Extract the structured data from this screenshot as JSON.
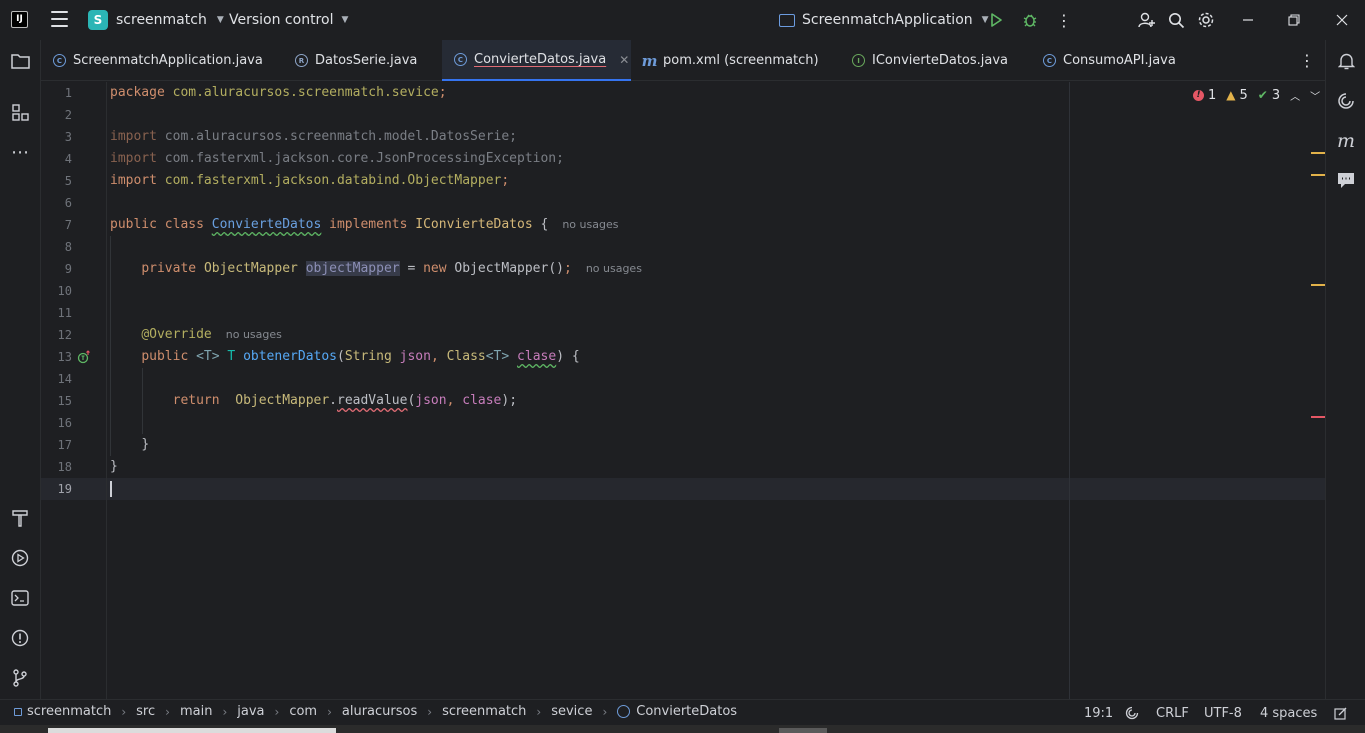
{
  "titlebar": {
    "project_letter": "S",
    "project_name": "screenmatch",
    "vcs_label": "Version control",
    "run_config": "ScreenmatchApplication",
    "icons": [
      "app-logo-icon",
      "main-menu-icon",
      "run-icon",
      "debug-icon",
      "more-vertical-icon",
      "add-user-icon",
      "search-icon",
      "settings-icon",
      "minimize-icon",
      "maximize-icon",
      "close-icon"
    ]
  },
  "tabs": [
    {
      "label": "ScreenmatchApplication.java",
      "icon": "class-icon",
      "active": false
    },
    {
      "label": "DatosSerie.java",
      "icon": "record-icon",
      "active": false
    },
    {
      "label": "ConvierteDatos.java",
      "icon": "class-icon",
      "active": true
    },
    {
      "label": "pom.xml (screenmatch)",
      "icon": "maven-icon",
      "active": false
    },
    {
      "label": "IConvierteDatos.java",
      "icon": "interface-icon",
      "active": false
    },
    {
      "label": "ConsumoAPI.java",
      "icon": "class-icon",
      "active": false
    }
  ],
  "inspections": {
    "errors": "1",
    "warnings": "5",
    "weak_warnings": "3"
  },
  "line_numbers": [
    "1",
    "2",
    "3",
    "4",
    "5",
    "6",
    "7",
    "8",
    "9",
    "10",
    "11",
    "12",
    "13",
    "14",
    "15",
    "16",
    "17",
    "18",
    "19"
  ],
  "code": {
    "l1_kw": "package",
    "l1_pkg": "com.aluracursos.screenmatch.sevice",
    "l1_semi": ";",
    "l3_kw": "import",
    "l3_path": "com.aluracursos.screenmatch.model.DatosSerie;",
    "l4_kw": "import",
    "l4_path": "com.fasterxml.jackson.core.JsonProcessingException;",
    "l5_kw": "import",
    "l5_path": "com.fasterxml.jackson.databind.ObjectMapper",
    "l5_semi": ";",
    "l7_kw": "public class",
    "l7_name": "ConvierteDatos",
    "l7_impl": "implements",
    "l7_iface": "IConvierteDatos",
    "l7_brace": "{",
    "l7_usages": "no usages",
    "l9_kw": "private",
    "l9_type": "ObjectMapper",
    "l9_field": "objectMapper",
    "l9_eq": "=",
    "l9_new": "new",
    "l9_ctor": "ObjectMapper()",
    "l9_semi": ";",
    "l9_usages": "no usages",
    "l12_ann": "@Override",
    "l12_usages": "no usages",
    "l13_kw": "public",
    "l13_generic": "<T>",
    "l13_ret": "T",
    "l13_fn": "obtenerDatos",
    "l13_open": "(",
    "l13_t1": "String",
    "l13_p1": "json",
    "l13_comma": ",",
    "l13_t2": "Class",
    "l13_t2g": "<T>",
    "l13_p2": "clase",
    "l13_close": ") {",
    "l15_kw": "return",
    "l15_cls": "ObjectMapper",
    "l15_dot": ".",
    "l15_fn": "readValue",
    "l15_open": "(",
    "l15_p1": "json",
    "l15_comma": ",",
    "l15_p2": "clase",
    "l15_close": ");",
    "l17": "}",
    "l18": "}"
  },
  "breadcrumb": [
    "screenmatch",
    "src",
    "main",
    "java",
    "com",
    "aluracursos",
    "screenmatch",
    "sevice",
    "ConvierteDatos"
  ],
  "status": {
    "position": "19:1",
    "line_sep": "CRLF",
    "encoding": "UTF-8",
    "indent": "4 spaces"
  },
  "colors": {
    "accent": "#3574f0",
    "error": "#e55765",
    "warning": "#e2b24a",
    "ok": "#5fb865"
  }
}
